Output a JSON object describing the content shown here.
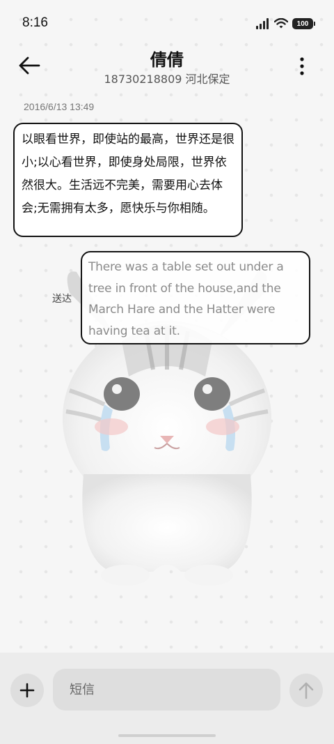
{
  "status_bar": {
    "time": "8:16",
    "battery": "100",
    "icons": [
      "signal-icon",
      "wifi-icon",
      "battery-icon"
    ]
  },
  "header": {
    "contact_name": "倩倩",
    "contact_subtitle": "18730218809 河北保定",
    "back_icon": "back-arrow-icon",
    "more_icon": "more-vertical-icon"
  },
  "conversation": {
    "timestamp": "2016/6/13 13:49",
    "incoming_message": "以眼看世界，即使站的最高，世界还是很小;以心看世界，即使身处局限，世界依然很大。生活远不完美，需要用心去体会;无需拥有太多，愿快乐与你相随。",
    "outgoing_status": "送达",
    "outgoing_message": "There was a table set out under a tree in front of the house,and the March Hare and the Hatter were having tea at it."
  },
  "composer": {
    "placeholder": "短信",
    "add_icon": "plus-icon",
    "send_icon": "arrow-up-icon"
  },
  "colors": {
    "bubble_border": "#111111",
    "outgoing_text": "#8a8a8a",
    "composer_bg": "#ececec",
    "control_bg": "#dedede"
  }
}
